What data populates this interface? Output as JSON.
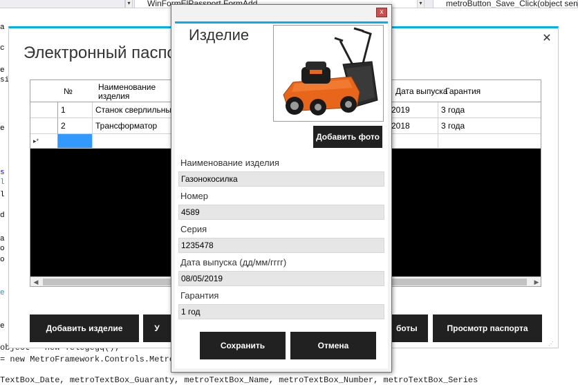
{
  "ide": {
    "combo_file": "WinFormElPassport.FormAdd",
    "combo_method": "metroButton_Save_Click(object sender",
    "code_line_1": "object = new Telegegq();",
    "code_line_2": "= new MetroFramework.Controls.MetroTextBox",
    "code_line_3": "TextBox_Date, metroTextBox_Guaranty, metroTextBox_Name, metroTextBox_Number, metroTextBox_Series"
  },
  "main_form": {
    "title": "Электронный паспорт",
    "close_symbol": "✕",
    "grid": {
      "columns": [
        "№",
        "Наименование изделия",
        "Дата выпуска",
        "Гарантия"
      ],
      "rows": [
        {
          "num": "1",
          "name": "Станок сверлильный",
          "date": "2019",
          "warranty": "3 года"
        },
        {
          "num": "2",
          "name": "Трансформатор",
          "date": "2018",
          "warranty": "3 года"
        }
      ],
      "new_row_marker": "▸*"
    },
    "buttons": {
      "add_item": "Добавить изделие",
      "edit": "У",
      "works": "боты",
      "view_passport": "Просмотр паспорта"
    }
  },
  "dialog": {
    "title": "Изделие",
    "close_symbol": "x",
    "photo_alt": "lawn-mower",
    "add_photo": "Добавить фото",
    "fields": {
      "name_label": "Наименование изделия",
      "name_value": "Газонокосилка",
      "number_label": "Номер",
      "number_value": "4589",
      "series_label": "Серия",
      "series_value": "1235478",
      "date_label": "Дата выпуска (дд/мм/гггг)",
      "date_value": "08/05/2019",
      "warranty_label": "Гарантия",
      "warranty_value": "1 год"
    },
    "save_button": "Сохранить",
    "cancel_button": "Отмена"
  },
  "colors": {
    "accent": "#00aff0",
    "button_bg": "#212121",
    "field_bg": "#e6e6e6",
    "selected_cell": "#3399ff",
    "grid_bg": "#000000"
  }
}
